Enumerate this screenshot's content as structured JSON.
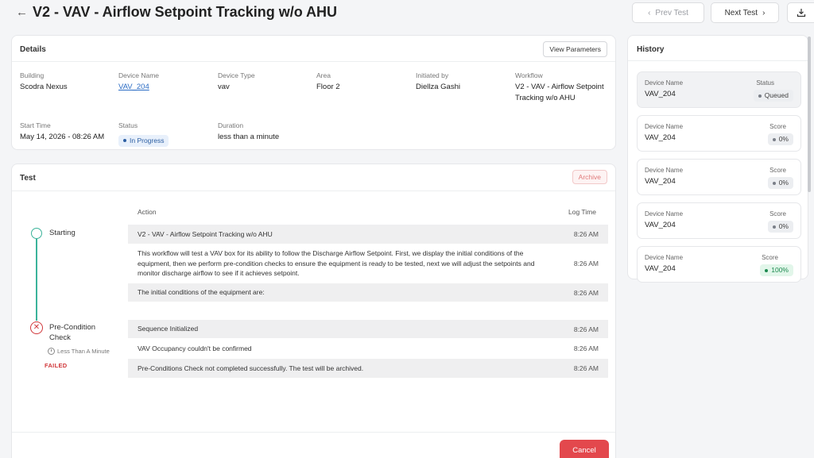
{
  "header": {
    "title": "V2 - VAV - Airflow Setpoint Tracking w/o AHU",
    "prev_label": "Prev Test",
    "next_label": "Next Test"
  },
  "details": {
    "title": "Details",
    "view_params_label": "View Parameters",
    "fields": {
      "building": {
        "label": "Building",
        "value": "Scodra Nexus"
      },
      "device_name": {
        "label": "Device Name",
        "value": "VAV_204"
      },
      "device_type": {
        "label": "Device Type",
        "value": "vav"
      },
      "area": {
        "label": "Area",
        "value": "Floor 2"
      },
      "initiated_by": {
        "label": "Initiated by",
        "value": "Diellza Gashi"
      },
      "workflow": {
        "label": "Workflow",
        "value": "V2 - VAV - Airflow Setpoint Tracking w/o AHU"
      },
      "start_time": {
        "label": "Start Time",
        "value": "May 14, 2026 - 08:26 AM"
      },
      "status": {
        "label": "Status",
        "value": "In Progress"
      },
      "duration": {
        "label": "Duration",
        "value": "less than a minute"
      }
    }
  },
  "test": {
    "title": "Test",
    "archive_label": "Archive",
    "col_action": "Action",
    "col_log_time": "Log Time",
    "steps": [
      {
        "label": "Starting"
      },
      {
        "label": "Pre-Condition Check",
        "duration": "Less Than A Minute",
        "result": "FAILED"
      }
    ],
    "rows": [
      {
        "text": "V2 - VAV - Airflow Setpoint Tracking w/o AHU",
        "time": "8:26 AM"
      },
      {
        "text": "This workflow will test a VAV box for its ability to follow the Discharge Airflow Setpoint. First, we display the initial conditions of the equipment, then we perform pre-condition checks to ensure the equipment is ready to be tested, next we will adjust the setpoints and monitor discharge airflow to see if it achieves setpoint.",
        "time": "8:26 AM"
      },
      {
        "text": "The initial conditions of the equipment are:",
        "time": "8:26 AM"
      },
      {
        "text": "Sequence Initialized",
        "time": "8:26 AM"
      },
      {
        "text": "VAV Occupancy couldn't be confirmed",
        "time": "8:26 AM"
      },
      {
        "text": "Pre-Conditions Check not completed successfully. The test will be archived.",
        "time": "8:26 AM"
      }
    ],
    "cancel_label": "Cancel"
  },
  "history": {
    "title": "History",
    "items": [
      {
        "name_label": "Device Name",
        "name": "VAV_204",
        "metric_label": "Status",
        "metric": "Queued"
      },
      {
        "name_label": "Device Name",
        "name": "VAV_204",
        "metric_label": "Score",
        "metric": "0%"
      },
      {
        "name_label": "Device Name",
        "name": "VAV_204",
        "metric_label": "Score",
        "metric": "0%"
      },
      {
        "name_label": "Device Name",
        "name": "VAV_204",
        "metric_label": "Score",
        "metric": "0%"
      },
      {
        "name_label": "Device Name",
        "name": "VAV_204",
        "metric_label": "Score",
        "metric": "100%"
      }
    ]
  },
  "colors": {
    "accent_link": "#2b6cc4",
    "success": "#3bb39a",
    "danger": "#d0373a",
    "cancel": "#e3484d"
  },
  "icons": [
    "arrow-left-icon",
    "chevron-left-icon",
    "chevron-right-icon",
    "download-icon",
    "check-circle-icon",
    "x-circle-icon",
    "clock-icon"
  ]
}
